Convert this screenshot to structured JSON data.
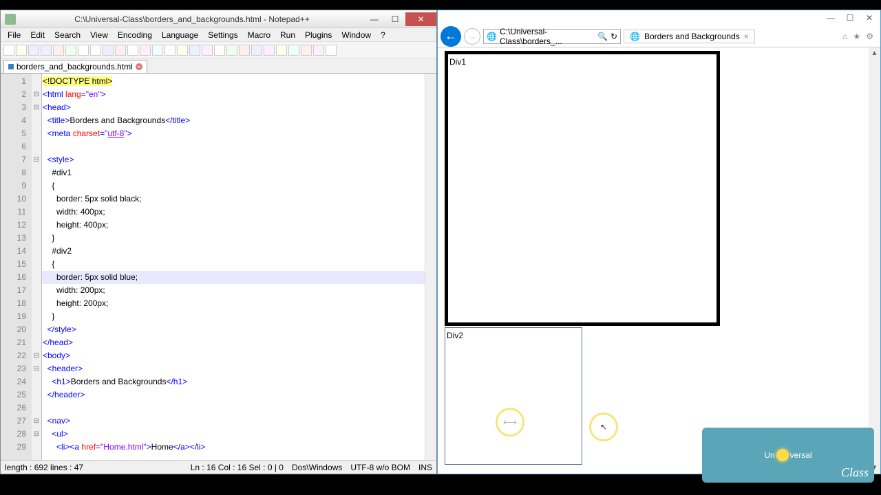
{
  "npp": {
    "title": "C:\\Universal-Class\\borders_and_backgrounds.html - Notepad++",
    "menu": [
      "File",
      "Edit",
      "Search",
      "View",
      "Encoding",
      "Language",
      "Settings",
      "Macro",
      "Run",
      "Plugins",
      "Window",
      "?"
    ],
    "tab": "borders_and_backgrounds.html",
    "status": {
      "left": "length : 692    lines : 47",
      "pos": "Ln : 16    Col : 16    Sel : 0 | 0",
      "eol": "Dos\\Windows",
      "enc": "UTF-8 w/o BOM",
      "mode": "INS"
    },
    "code": [
      {
        "n": 1,
        "f": "",
        "h": "<span class='s-doctype'>&lt;!DOCTYPE html&gt;</span>"
      },
      {
        "n": 2,
        "f": "⊟",
        "h": "<span class='s-tag'>&lt;html</span> <span class='s-attr'>lang</span><span class='s-tag'>=</span><span class='s-str'>\"en\"</span><span class='s-tag'>&gt;</span>"
      },
      {
        "n": 3,
        "f": "⊟",
        "h": "<span class='s-tag'>&lt;head&gt;</span>"
      },
      {
        "n": 4,
        "f": "",
        "h": "  <span class='s-tag'>&lt;title&gt;</span><span class='s-txt'>Borders and Backgrounds</span><span class='s-tag'>&lt;/title&gt;</span>"
      },
      {
        "n": 5,
        "f": "",
        "h": "  <span class='s-tag'>&lt;meta</span> <span class='s-attr'>charset</span><span class='s-tag'>=</span><span class='s-str'>\"<u>utf-8</u>\"</span><span class='s-tag'>&gt;</span>"
      },
      {
        "n": 6,
        "f": "",
        "h": ""
      },
      {
        "n": 7,
        "f": "⊟",
        "h": "  <span class='s-tag'>&lt;style&gt;</span>"
      },
      {
        "n": 8,
        "f": "",
        "h": "    <span class='s-sel'>#div1</span>"
      },
      {
        "n": 9,
        "f": "",
        "h": "    <span class='s-txt'>{</span>"
      },
      {
        "n": 10,
        "f": "",
        "h": "      <span class='s-prop'>border: 5px solid black;</span>"
      },
      {
        "n": 11,
        "f": "",
        "h": "      <span class='s-prop'>width: 400px;</span>"
      },
      {
        "n": 12,
        "f": "",
        "h": "      <span class='s-prop'>height: 400px;</span>"
      },
      {
        "n": 13,
        "f": "",
        "h": "    <span class='s-txt'>}</span>"
      },
      {
        "n": 14,
        "f": "",
        "h": "    <span class='s-sel'>#div2</span>"
      },
      {
        "n": 15,
        "f": "",
        "h": "    <span class='s-txt'>{</span>"
      },
      {
        "n": 16,
        "f": "",
        "h": "      <span class='s-prop'>border: 5px solid blue;</span>",
        "hl": true
      },
      {
        "n": 17,
        "f": "",
        "h": "      <span class='s-prop'>width: 200px;</span>"
      },
      {
        "n": 18,
        "f": "",
        "h": "      <span class='s-prop'>height: 200px;</span>"
      },
      {
        "n": 19,
        "f": "",
        "h": "    <span class='s-txt'>}</span>"
      },
      {
        "n": 20,
        "f": "",
        "h": "  <span class='s-tag'>&lt;/style&gt;</span>"
      },
      {
        "n": 21,
        "f": "",
        "h": "<span class='s-tag'>&lt;/head&gt;</span>"
      },
      {
        "n": 22,
        "f": "⊟",
        "h": "<span class='s-tag'>&lt;body&gt;</span>"
      },
      {
        "n": 23,
        "f": "⊟",
        "h": "  <span class='s-tag'>&lt;header&gt;</span>"
      },
      {
        "n": 24,
        "f": "",
        "h": "    <span class='s-tag'>&lt;h1&gt;</span><span class='s-txt'>Borders and Backgrounds</span><span class='s-tag'>&lt;/h1&gt;</span>"
      },
      {
        "n": 25,
        "f": "",
        "h": "  <span class='s-tag'>&lt;/header&gt;</span>"
      },
      {
        "n": 26,
        "f": "",
        "h": ""
      },
      {
        "n": 27,
        "f": "⊟",
        "h": "  <span class='s-tag'>&lt;nav&gt;</span>"
      },
      {
        "n": 28,
        "f": "⊟",
        "h": "    <span class='s-tag'>&lt;ul&gt;</span>"
      },
      {
        "n": 29,
        "f": "",
        "h": "      <span class='s-tag'>&lt;li&gt;&lt;a</span> <span class='s-attr'>href</span><span class='s-tag'>=</span><span class='s-str'>\"Home.html\"</span><span class='s-tag'>&gt;</span><span class='s-txt'>Home</span><span class='s-tag'>&lt;/a&gt;&lt;/li&gt;</span>"
      }
    ]
  },
  "ie": {
    "address": "C:\\Universal-Class\\borders_...",
    "tab": "Borders and Backgrounds",
    "link_frag": "",
    "div1_text": "Div1",
    "div2_text": "Div2"
  },
  "logo": {
    "main": "Un",
    "main2": "versal",
    "sub": "Class"
  }
}
